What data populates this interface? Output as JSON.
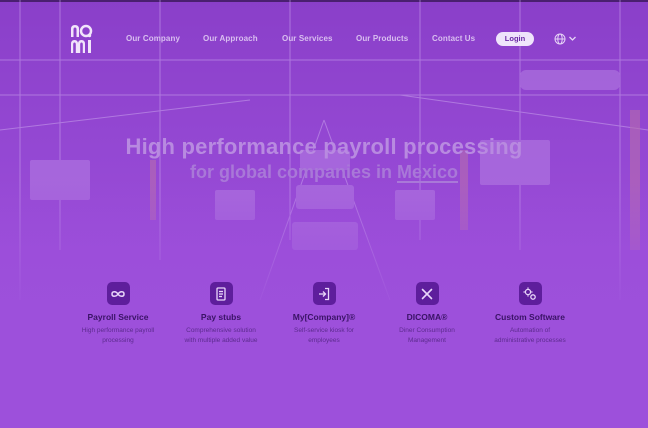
{
  "brand": {
    "logo_text": "nomi"
  },
  "nav": {
    "links": [
      "Our Company",
      "Our Approach",
      "Our Services",
      "Our Products",
      "Contact Us"
    ],
    "login_label": "Login",
    "language_icon": "globe-icon"
  },
  "hero": {
    "headline": "High performance payroll processing",
    "subline_prefix": "for global companies in ",
    "subline_highlight": "Mexico"
  },
  "services": [
    {
      "icon": "infinity-icon",
      "title": "Payroll Service",
      "desc_line1": "High performance payroll",
      "desc_line2": "processing"
    },
    {
      "icon": "receipt-icon",
      "title": "Pay stubs",
      "desc_line1": "Comprehensive solution",
      "desc_line2": "with multiple added value"
    },
    {
      "icon": "login-icon",
      "title": "My[Company]®",
      "desc_line1": "Self-service kiosk for",
      "desc_line2": "employees"
    },
    {
      "icon": "utensils-icon",
      "title": "DICOMA®",
      "desc_line1": "Diner Consumption",
      "desc_line2": "Management"
    },
    {
      "icon": "gears-icon",
      "title": "Custom Software",
      "desc_line1": "Automation of",
      "desc_line2": "administrative processes"
    }
  ],
  "colors": {
    "accent": "#9d50db",
    "icon_bg": "#5e1e9c",
    "title": "#3a1366"
  }
}
